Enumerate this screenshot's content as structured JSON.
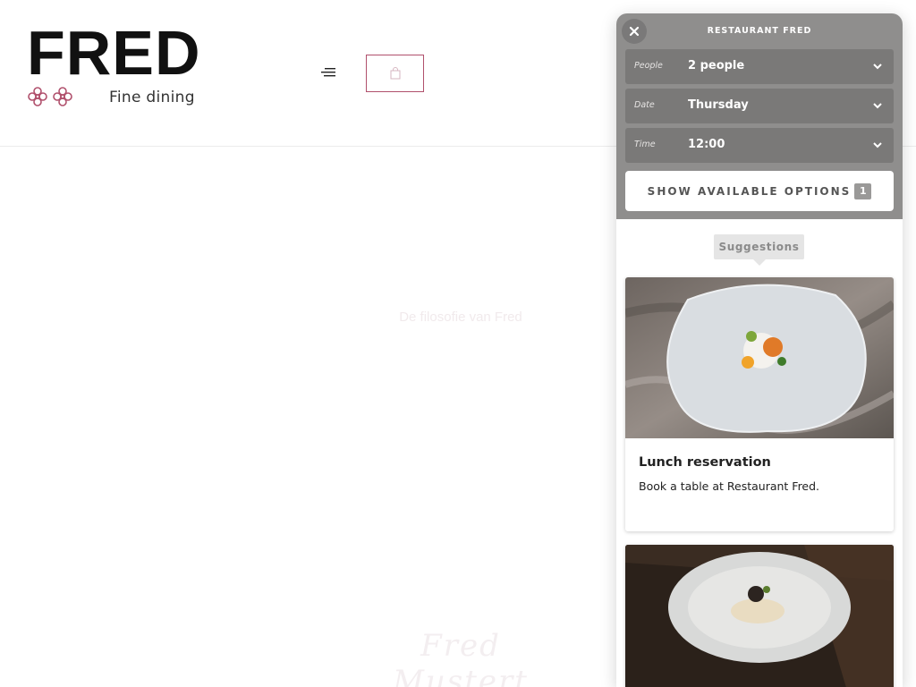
{
  "header": {
    "logo_text": "FRED",
    "logo_subtitle": "Fine dining",
    "menu_icon": "hamburger-menu-icon",
    "cart_icon": "shopping-bag-icon"
  },
  "page": {
    "faint_heading": "De filosofie van Fred",
    "faint_signature": "Fred Mustert"
  },
  "widget": {
    "title": "RESTAURANT FRED",
    "close_icon": "close-icon",
    "fields": [
      {
        "label": "People",
        "value": "2 people"
      },
      {
        "label": "Date",
        "value": "Thursday"
      },
      {
        "label": "Time",
        "value": "12:00"
      }
    ],
    "show_button": {
      "label": "SHOW AVAILABLE OPTIONS",
      "count": "1"
    },
    "suggestions_label": "Suggestions",
    "cards": [
      {
        "title": "Lunch reservation",
        "description": "Book a table at Restaurant Fred."
      },
      {
        "title": "",
        "description": ""
      }
    ]
  },
  "colors": {
    "accent": "#b0506c",
    "widget_header": "#8f8e8d",
    "field_bg": "#7a7978"
  }
}
